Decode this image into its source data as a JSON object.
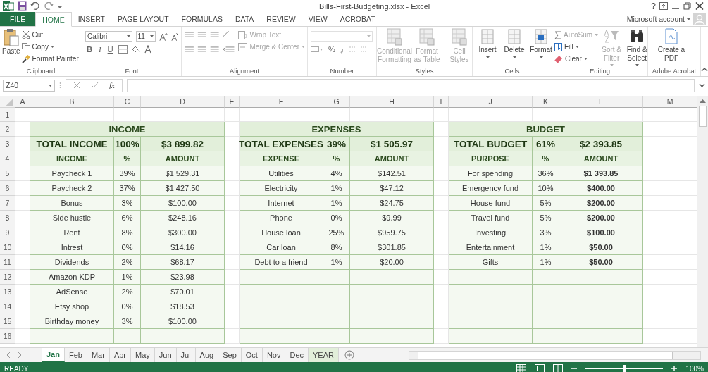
{
  "window": {
    "title": "Bills-First-Budgeting.xlsx - Excel",
    "account": "Microsoft account",
    "help": "?"
  },
  "ribbon_tabs": [
    {
      "label": "FILE",
      "kind": "file",
      "selected": false
    },
    {
      "label": "HOME",
      "kind": "tab",
      "selected": true
    },
    {
      "label": "INSERT",
      "kind": "tab",
      "selected": false
    },
    {
      "label": "PAGE LAYOUT",
      "kind": "tab",
      "selected": false
    },
    {
      "label": "FORMULAS",
      "kind": "tab",
      "selected": false
    },
    {
      "label": "DATA",
      "kind": "tab",
      "selected": false
    },
    {
      "label": "REVIEW",
      "kind": "tab",
      "selected": false
    },
    {
      "label": "VIEW",
      "kind": "tab",
      "selected": false
    },
    {
      "label": "ACROBAT",
      "kind": "tab",
      "selected": false
    }
  ],
  "ribbon": {
    "clipboard": {
      "label": "Clipboard",
      "paste": "Paste",
      "cut": "Cut",
      "copy": "Copy",
      "format_painter": "Format Painter"
    },
    "font": {
      "label": "Font",
      "font_name": "Calibri",
      "font_size": "11",
      "styles": [
        "B",
        "I",
        "U"
      ]
    },
    "alignment": {
      "label": "Alignment",
      "wrap_text": {
        "label": "Wrap Text",
        "disabled": true
      },
      "merge": {
        "label": "Merge & Center",
        "disabled": true
      }
    },
    "number": {
      "label": "Number",
      "percent": "%"
    },
    "styles": {
      "label": "Styles",
      "commands": [
        {
          "label": "Conditional Formatting",
          "disabled": true
        },
        {
          "label": "Format as Table",
          "disabled": true
        },
        {
          "label": "Cell Styles",
          "disabled": true
        }
      ]
    },
    "cells": {
      "label": "Cells",
      "commands": [
        {
          "label": "Insert",
          "disabled": false
        },
        {
          "label": "Delete",
          "disabled": false
        },
        {
          "label": "Format",
          "disabled": false
        }
      ]
    },
    "editing": {
      "label": "Editing",
      "small": [
        {
          "label": "AutoSum",
          "kind": "sum",
          "disabled": true
        },
        {
          "label": "Fill",
          "kind": "fill",
          "disabled": false
        },
        {
          "label": "Clear",
          "kind": "clear",
          "disabled": false
        }
      ],
      "large": [
        {
          "label": "Sort & Filter",
          "kind": "sort",
          "disabled": true
        },
        {
          "label": "Find & Select",
          "kind": "find",
          "disabled": false
        }
      ]
    },
    "acrobat": {
      "label": "Adobe Acrobat",
      "create": "Create a PDF"
    }
  },
  "formula_bar": {
    "name_box": "Z40",
    "fx": "fx"
  },
  "sheet": {
    "columns": [
      "A",
      "B",
      "C",
      "D",
      "E",
      "F",
      "G",
      "H",
      "I",
      "J",
      "K",
      "L",
      "M"
    ],
    "row_numbers": [
      "1",
      "2",
      "3",
      "4",
      "5",
      "6",
      "7",
      "8",
      "9",
      "10",
      "11",
      "12",
      "13",
      "14",
      "15",
      "16"
    ],
    "tables": [
      {
        "title": "INCOME",
        "total_label": "TOTAL INCOME",
        "total_percent": "100%",
        "total_amount": "$3 899.82",
        "headers": [
          "INCOME",
          "%",
          "AMOUNT"
        ],
        "amount_bold": false,
        "rows": [
          [
            "Paycheck 1",
            "39%",
            "$1 529.31"
          ],
          [
            "Paycheck 2",
            "37%",
            "$1 427.50"
          ],
          [
            "Bonus",
            "3%",
            "$100.00"
          ],
          [
            "Side hustle",
            "6%",
            "$248.16"
          ],
          [
            "Rent",
            "8%",
            "$300.00"
          ],
          [
            "Intrest",
            "0%",
            "$14.16"
          ],
          [
            "Dividends",
            "2%",
            "$68.17"
          ],
          [
            "Amazon KDP",
            "1%",
            "$23.98"
          ],
          [
            "AdSense",
            "2%",
            "$70.01"
          ],
          [
            "Etsy shop",
            "0%",
            "$18.53"
          ],
          [
            "Birthday money",
            "3%",
            "$100.00"
          ]
        ]
      },
      {
        "title": "EXPENSES",
        "total_label": "TOTAL EXPENSES",
        "total_percent": "39%",
        "total_amount": "$1 505.97",
        "headers": [
          "EXPENSE",
          "%",
          "AMOUNT"
        ],
        "amount_bold": false,
        "rows": [
          [
            "Utilities",
            "4%",
            "$142.51"
          ],
          [
            "Electricity",
            "1%",
            "$47.12"
          ],
          [
            "Internet",
            "1%",
            "$24.75"
          ],
          [
            "Phone",
            "0%",
            "$9.99"
          ],
          [
            "House loan",
            "25%",
            "$959.75"
          ],
          [
            "Car loan",
            "8%",
            "$301.85"
          ],
          [
            "Debt to a friend",
            "1%",
            "$20.00"
          ]
        ]
      },
      {
        "title": "BUDGET",
        "total_label": "TOTAL BUDGET",
        "total_percent": "61%",
        "total_amount": "$2 393.85",
        "headers": [
          "PURPOSE",
          "%",
          "AMOUNT"
        ],
        "amount_bold": true,
        "rows": [
          [
            "For spending",
            "36%",
            "$1 393.85"
          ],
          [
            "Emergency fund",
            "10%",
            "$400.00"
          ],
          [
            "House fund",
            "5%",
            "$200.00"
          ],
          [
            "Travel fund",
            "5%",
            "$200.00"
          ],
          [
            "Investing",
            "3%",
            "$100.00"
          ],
          [
            "Entertainment",
            "1%",
            "$50.00"
          ],
          [
            "Gifts",
            "1%",
            "$50.00"
          ]
        ]
      }
    ]
  },
  "sheet_tabs": [
    {
      "label": "Jan",
      "selected": true
    },
    {
      "label": "Feb",
      "selected": false
    },
    {
      "label": "Mar",
      "selected": false
    },
    {
      "label": "Apr",
      "selected": false
    },
    {
      "label": "May",
      "selected": false
    },
    {
      "label": "Jun",
      "selected": false
    },
    {
      "label": "Jul",
      "selected": false
    },
    {
      "label": "Aug",
      "selected": false
    },
    {
      "label": "Sep",
      "selected": false
    },
    {
      "label": "Oct",
      "selected": false
    },
    {
      "label": "Nov",
      "selected": false
    },
    {
      "label": "Dec",
      "selected": false
    },
    {
      "label": "YEAR",
      "selected": false,
      "color": "#e2efda"
    }
  ],
  "status_bar": {
    "status": "READY",
    "zoom": "100%",
    "zoom_slider": {
      "level": 0.5
    }
  }
}
